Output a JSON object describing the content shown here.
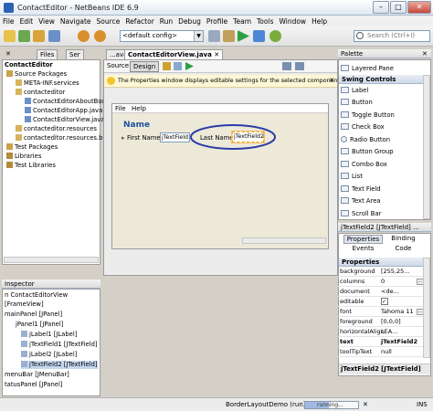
{
  "window": {
    "title": "ContactEditor - NetBeans IDE 6.9",
    "min": "–",
    "max": "□",
    "close": "✕"
  },
  "menu": [
    "File",
    "Edit",
    "View",
    "Navigate",
    "Source",
    "Refactor",
    "Run",
    "Debug",
    "Profile",
    "Team",
    "Tools",
    "Window",
    "Help"
  ],
  "toolbar": {
    "config": "<default config>",
    "config_arrow": "▼",
    "search_placeholder": "Search (Ctrl+I)"
  },
  "projects": {
    "tabs": [
      "Files",
      "Ser"
    ],
    "close_glyph": "✕",
    "nodes": [
      "ContactEditor",
      "Source Packages",
      "META-INF.services",
      "contacteditor",
      "ContactEditorAboutBox.jav",
      "ContactEditorApp.java",
      "ContactEditorView.java",
      "contacteditor.resources",
      "contacteditor.resources.busy",
      "Test Packages",
      "Libraries",
      "Test Libraries"
    ]
  },
  "inspector": {
    "title": "Inspector",
    "nodes": [
      "n ContactEditorView",
      "[FrameView]",
      "mainPanel [JPanel]",
      "jPanel1 [JPanel]",
      "jLabel1 [JLabel]",
      "jTextField1 [JTextField]",
      "jLabel2 [JLabel]",
      "jTextField2 [JTextField]",
      "menuBar [JMenuBar]",
      "tatusPanel [JPanel]"
    ]
  },
  "editor": {
    "tabs": [
      "...ava",
      "ContactEditorView.java"
    ],
    "tab_close": "✕",
    "source_label": "Source",
    "design_label": "Design",
    "hint": "The Properties window displays editable settings for the selected components.",
    "hint_close": "✕",
    "form_menu": [
      "File",
      "Help"
    ],
    "panel_title": "Name",
    "first_name_label": "First Name:",
    "first_name_field": "jTextField1",
    "last_name_label": "Last Name:",
    "last_name_field": "jTextField2"
  },
  "palette": {
    "title": "Palette",
    "close_glyph": "✕",
    "top_item": "Layered Pane",
    "section": "Swing Controls",
    "items": [
      "Label",
      "Button",
      "Toggle Button",
      "Check Box",
      "Radio Button",
      "Button Group",
      "Combo Box",
      "List",
      "Text Field",
      "Text Area",
      "Scroll Bar"
    ]
  },
  "properties": {
    "title": "jTextField2 [JTextField] ...",
    "tabs": [
      "Properties",
      "Binding",
      "Events",
      "Code"
    ],
    "section": "Properties",
    "more_glyph": "…",
    "rows": [
      {
        "name": "background",
        "value": "[255,25..."
      },
      {
        "name": "columns",
        "value": "0"
      },
      {
        "name": "document",
        "value": "<de..."
      },
      {
        "name": "editable",
        "value": "✓"
      },
      {
        "name": "font",
        "value": "Tahoma 11"
      },
      {
        "name": "foreground",
        "value": "[0,0,0]"
      },
      {
        "name": "horizontalAlign",
        "value": "LEA..."
      },
      {
        "name": "text",
        "value": "jTextField2"
      },
      {
        "name": "toolTipText",
        "value": "null"
      }
    ],
    "footer": "jTextField2 [JTextField]"
  },
  "status": {
    "run": "BorderLayoutDemo (run)",
    "progress": "running...",
    "ins": "INS"
  },
  "colors": {
    "accent": "#2a62b4",
    "oval": "#2c3aa8",
    "selection": "#f5a623"
  }
}
